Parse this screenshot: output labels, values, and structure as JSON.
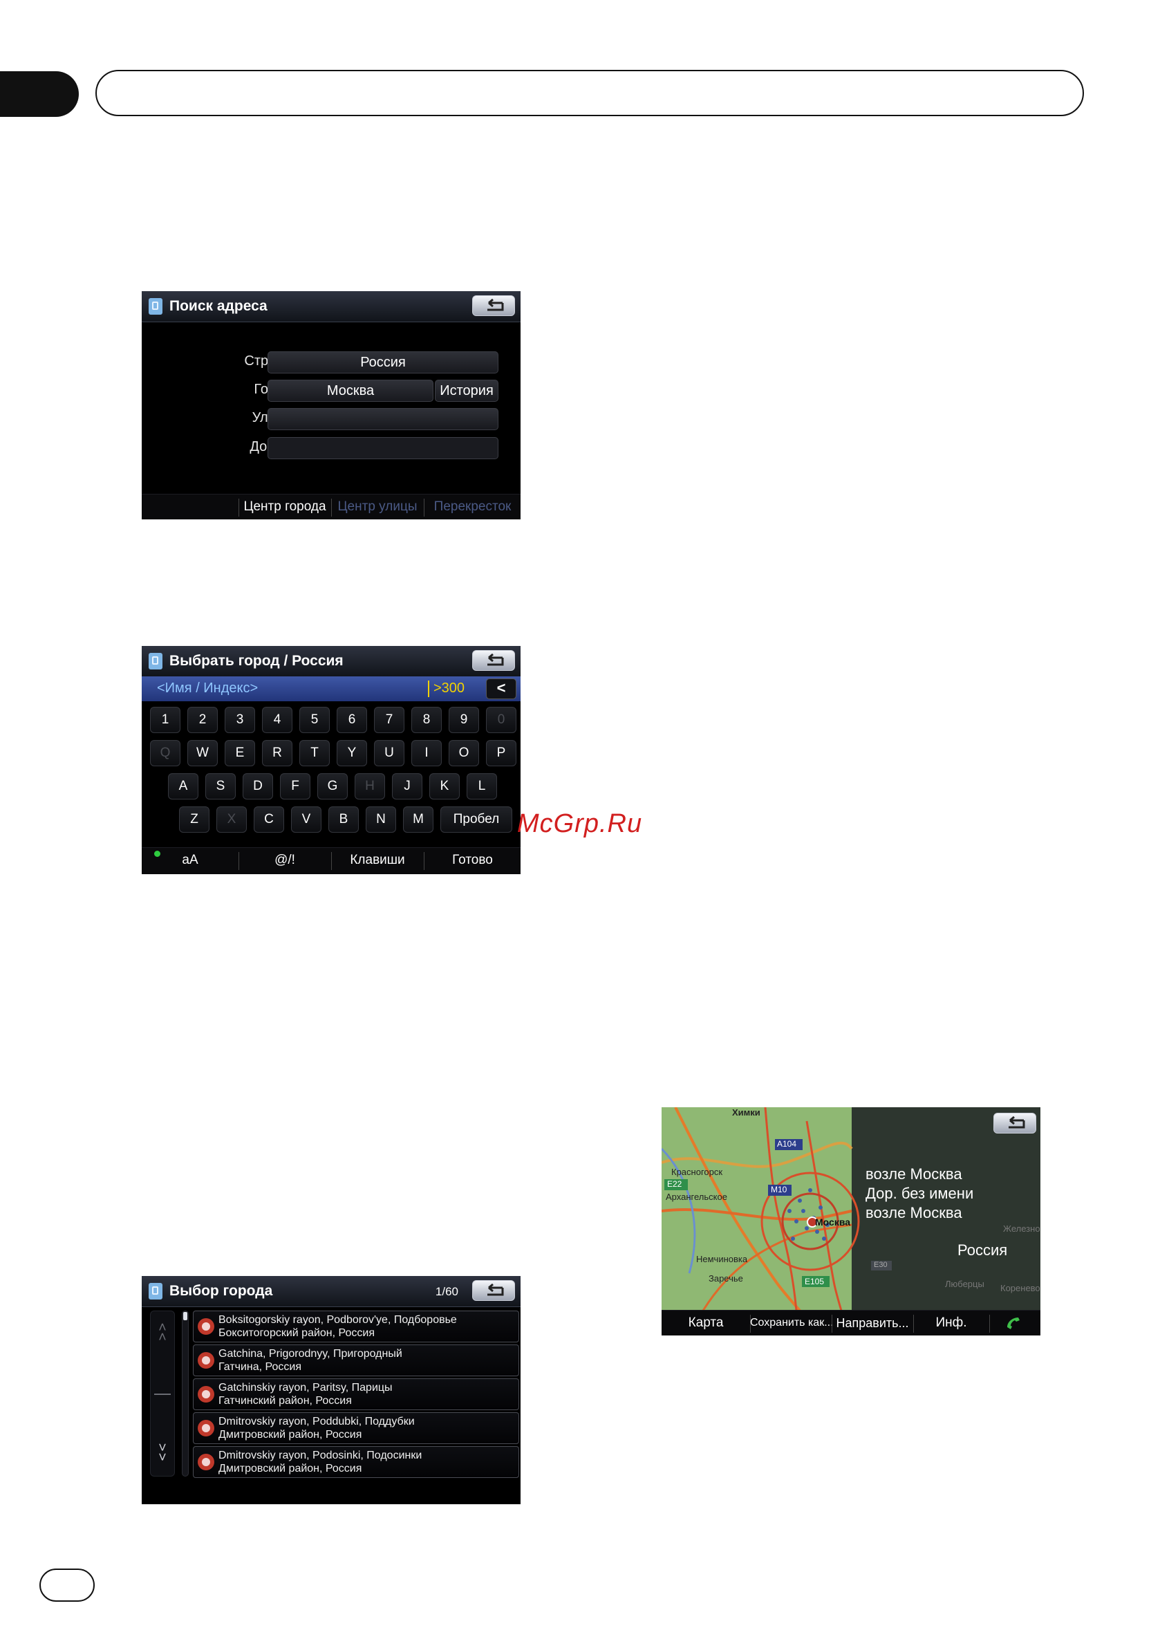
{
  "watermark": "McGrp.Ru",
  "screen1": {
    "title": "Поиск адреса",
    "country_label": "Страна:",
    "country_value": "Россия",
    "city_label": "Город:",
    "city_value": "Москва",
    "history_button": "История",
    "street_label": "Улица:",
    "street_value": "",
    "house_label": "Дом №",
    "house_value": "",
    "bottom": [
      "Центр города",
      "Центр улицы",
      "Перекресток"
    ]
  },
  "screen2": {
    "title": "Выбрать город / Россия",
    "input_placeholder": "<Имя / Индекс>",
    "count": ">300",
    "backspace": "<",
    "keys_row1": [
      "1",
      "2",
      "3",
      "4",
      "5",
      "6",
      "7",
      "8",
      "9",
      "0"
    ],
    "keys_row2": [
      "Q",
      "W",
      "E",
      "R",
      "T",
      "Y",
      "U",
      "I",
      "O",
      "P"
    ],
    "keys_row3": [
      "A",
      "S",
      "D",
      "F",
      "G",
      "H",
      "J",
      "K",
      "L"
    ],
    "keys_row4": [
      "Z",
      "X",
      "C",
      "V",
      "B",
      "N",
      "M"
    ],
    "space_key": "Пробел",
    "bottom": [
      "aA",
      "@/!",
      "Клавиши",
      "Готово"
    ]
  },
  "screen3": {
    "title": "Выбор города",
    "page": "1/60",
    "items": [
      {
        "line1": "Boksitogorskiy rayon, Podborov'ye, Подборовье",
        "line2": "Бокситогорский район, Россия"
      },
      {
        "line1": "Gatchina, Prigorodnyy, Пригородный",
        "line2": "Гатчина, Россия"
      },
      {
        "line1": "Gatchinskiy rayon, Paritsy, Парицы",
        "line2": "Гатчинский район, Россия"
      },
      {
        "line1": "Dmitrovskiy rayon, Poddubki, Поддубки",
        "line2": "Дмитровский район, Россия"
      },
      {
        "line1": "Dmitrovskiy rayon, Podosinki, Подосинки",
        "line2": "Дмитровский район, Россия"
      }
    ]
  },
  "screen4": {
    "info_line1": "возле Москва",
    "info_line2": "Дор. без имени",
    "info_line3": "возле Москва",
    "info_country": "Россия",
    "map_labels": {
      "khimki": "Химки",
      "krasnogorsk": "Красногорск",
      "arkhangelskoe": "Архангельское",
      "moskva": "Москва",
      "nemchinovka": "Немчиновка",
      "zarechye": "Заречье",
      "lyubertsy": "Люберцы",
      "zheleznodorozhny": "Железно",
      "korenevo": "Коренево",
      "a104": "A104",
      "m10": "M10",
      "e22": "E22",
      "e105": "E105",
      "e30": "E30"
    },
    "bottom": [
      "Карта",
      "Сохранить как...",
      "Направить...",
      "Инф."
    ]
  }
}
